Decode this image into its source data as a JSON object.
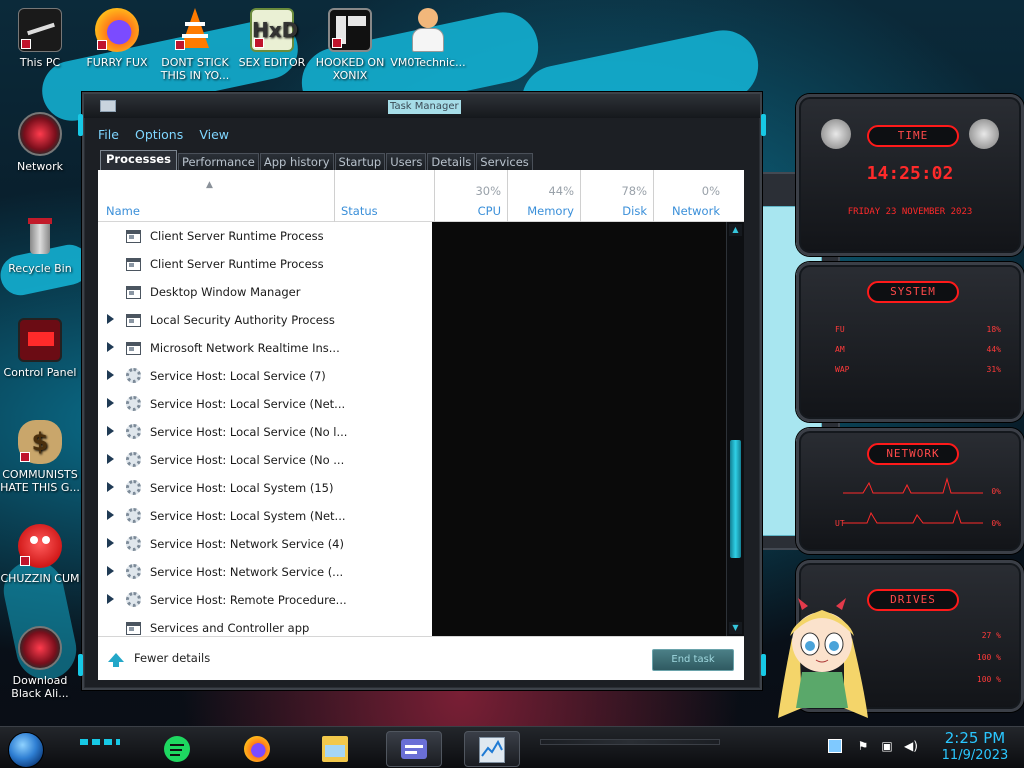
{
  "desktop": {
    "icons": [
      {
        "label": "This PC",
        "icon": "this-pc-icon"
      },
      {
        "label": "FURRY FUX",
        "icon": "firefox-icon"
      },
      {
        "label": "DONT STICK THIS IN YO...",
        "icon": "vlc-icon"
      },
      {
        "label": "SEX EDITOR",
        "icon": "hxd-editor-icon"
      },
      {
        "label": "HOOKED ON XONIX",
        "icon": "xonix-icon"
      },
      {
        "label": "VM0Technic...",
        "icon": "doctor-icon"
      },
      {
        "label": "Network",
        "icon": "network-icon"
      },
      {
        "label": "Recycle Bin",
        "icon": "recycle-bin-icon"
      },
      {
        "label": "Control Panel",
        "icon": "control-panel-icon"
      },
      {
        "label": "COMMUNISTS HATE THIS G...",
        "icon": "money-bag-icon"
      },
      {
        "label": "CHUZZIN CUM",
        "icon": "chuzzle-icon"
      },
      {
        "label": "Download Black Ali...",
        "icon": "alienware-icon"
      }
    ]
  },
  "gadgets": {
    "time": {
      "title": "TIME",
      "clock": "14:25:02",
      "date": "FRIDAY 23 NOVEMBER 2023"
    },
    "system": {
      "title": "SYSTEM",
      "rows": [
        {
          "key": "FU",
          "value": "18%"
        },
        {
          "key": "AM",
          "value": "44%"
        },
        {
          "key": "WAP",
          "value": "31%"
        }
      ]
    },
    "network": {
      "title": "NETWORK",
      "rows": [
        {
          "key": "",
          "value": "0%"
        },
        {
          "key": "UT",
          "value": "0%"
        }
      ]
    },
    "drives": {
      "title": "DRIVES",
      "rows": [
        {
          "key": "",
          "value": "27 %"
        },
        {
          "key": "",
          "value": "100 %"
        },
        {
          "key": "",
          "value": "100 %"
        }
      ]
    }
  },
  "task_manager": {
    "title": "Task Manager",
    "menu": [
      "File",
      "Options",
      "View"
    ],
    "tabs": [
      "Processes",
      "Performance",
      "App history",
      "Startup",
      "Users",
      "Details",
      "Services"
    ],
    "active_tab": "Processes",
    "columns": {
      "name": "Name",
      "status": "Status",
      "cpu": {
        "label": "CPU",
        "percent": "30%"
      },
      "memory": {
        "label": "Memory",
        "percent": "44%"
      },
      "disk": {
        "label": "Disk",
        "percent": "78%"
      },
      "network": {
        "label": "Network",
        "percent": "0%"
      }
    },
    "processes": [
      {
        "name": "Client Server Runtime Process",
        "icon": "window",
        "expandable": false
      },
      {
        "name": "Client Server Runtime Process",
        "icon": "window",
        "expandable": false
      },
      {
        "name": "Desktop Window Manager",
        "icon": "window",
        "expandable": false
      },
      {
        "name": "Local Security Authority Process",
        "icon": "window",
        "expandable": true
      },
      {
        "name": "Microsoft Network Realtime Ins...",
        "icon": "window",
        "expandable": true
      },
      {
        "name": "Service Host: Local Service (7)",
        "icon": "gear",
        "expandable": true
      },
      {
        "name": "Service Host: Local Service (Net...",
        "icon": "gear",
        "expandable": true
      },
      {
        "name": "Service Host: Local Service (No l...",
        "icon": "gear",
        "expandable": true
      },
      {
        "name": "Service Host: Local Service (No ...",
        "icon": "gear",
        "expandable": true
      },
      {
        "name": "Service Host: Local System (15)",
        "icon": "gear",
        "expandable": true
      },
      {
        "name": "Service Host: Local System (Net...",
        "icon": "gear",
        "expandable": true
      },
      {
        "name": "Service Host: Network Service (4)",
        "icon": "gear",
        "expandable": true
      },
      {
        "name": "Service Host: Network Service (...",
        "icon": "gear",
        "expandable": true
      },
      {
        "name": "Service Host: Remote Procedure...",
        "icon": "gear",
        "expandable": true
      },
      {
        "name": "Services and Controller app",
        "icon": "window",
        "expandable": false
      }
    ],
    "footer": {
      "fewer_details": "Fewer details",
      "end_task": "End task"
    }
  },
  "taskbar": {
    "pinned": [
      "spotify-icon",
      "firefox-icon",
      "file-explorer-icon",
      "id-card-icon",
      "task-manager-icon"
    ],
    "tray_icons": [
      "show-desktop-icon",
      "flag-icon",
      "network-tray-icon",
      "volume-icon"
    ],
    "clock_time": "2:25 PM",
    "clock_date": "11/9/2023"
  }
}
